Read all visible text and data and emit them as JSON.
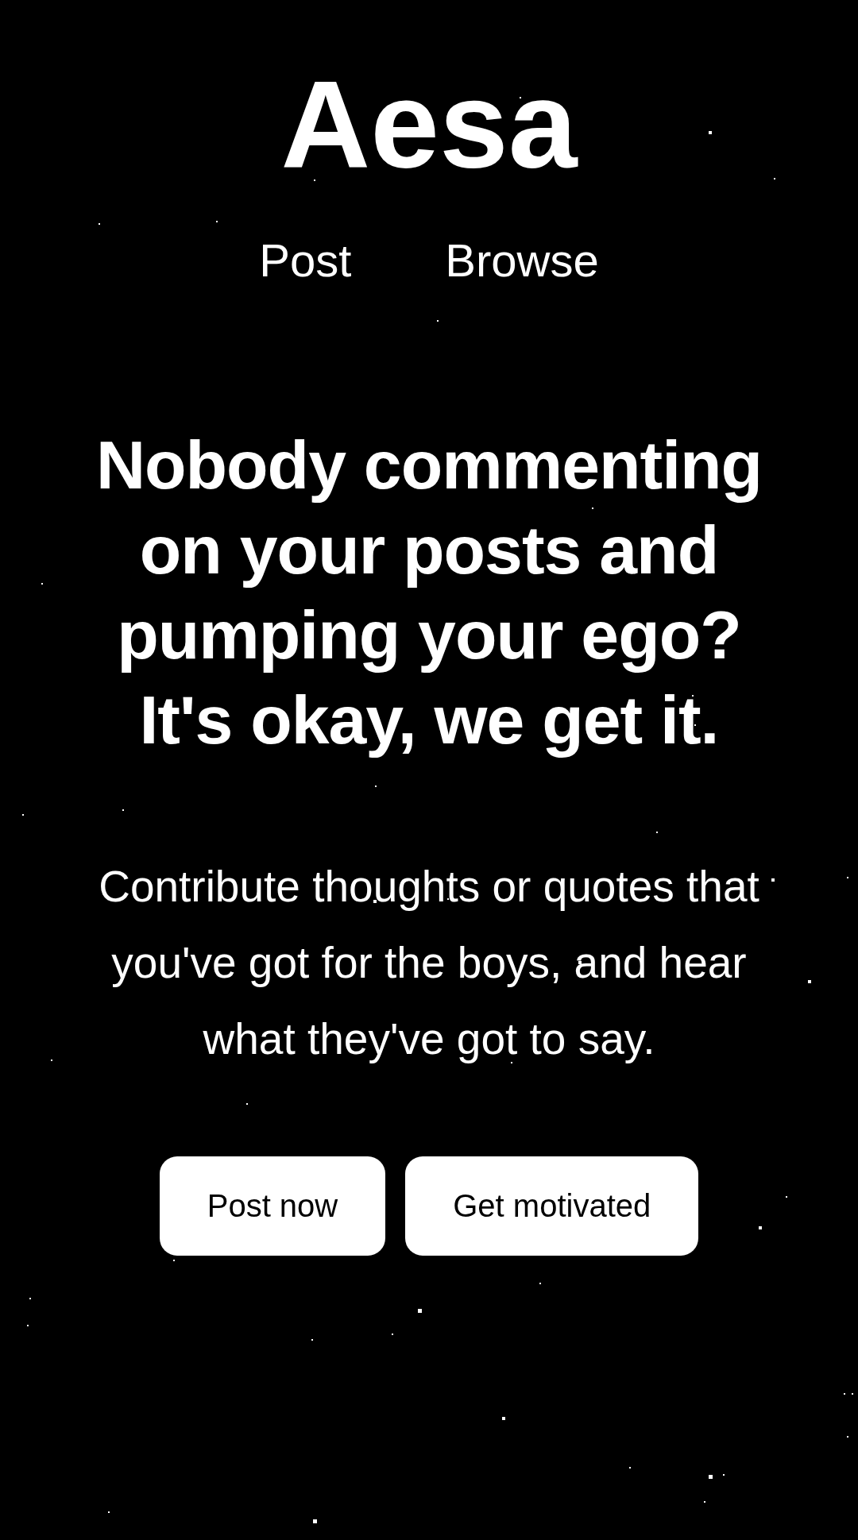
{
  "brand": "Aesa",
  "nav": [
    {
      "label": "Post"
    },
    {
      "label": "Browse"
    }
  ],
  "headline": "Nobody commenting on your posts and pumping your ego? It's okay, we get it.",
  "subtitle": "Contribute thoughts or quotes that you've got for the boys, and hear what they've got to say.",
  "buttons": [
    {
      "label": "Post now"
    },
    {
      "label": "Get motivated"
    }
  ]
}
